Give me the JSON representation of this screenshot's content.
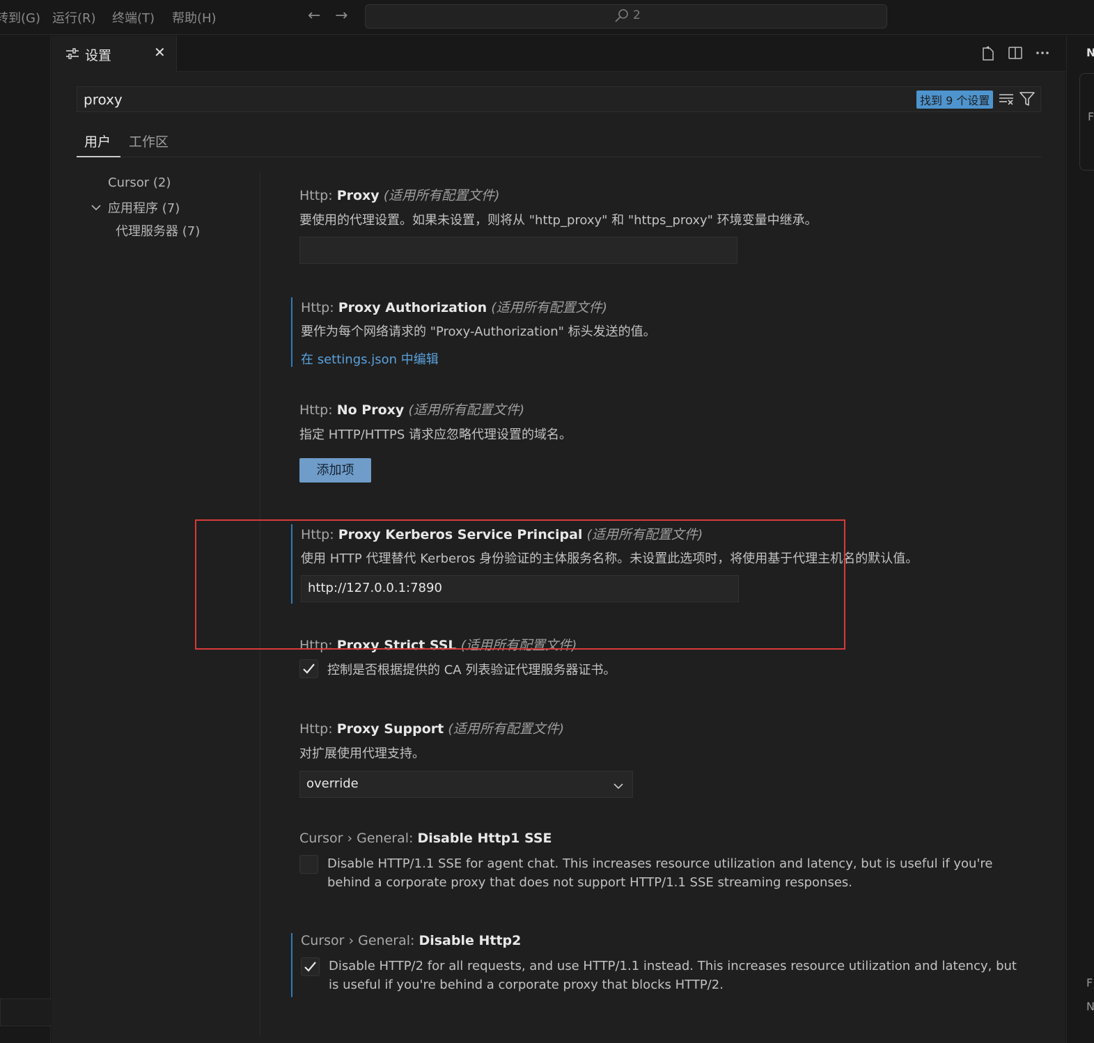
{
  "menubar": {
    "items": [
      "转到(G)",
      "运行(R)",
      "终端(T)",
      "帮助(H)"
    ],
    "back": "←",
    "forward": "→",
    "command_center": "2"
  },
  "tab": {
    "label": "设置",
    "close": "✕"
  },
  "search": {
    "query": "proxy",
    "found_badge": "找到 9 个设置"
  },
  "scope_tabs": [
    "用户",
    "工作区"
  ],
  "toc": {
    "cursor": "Cursor (2)",
    "application": "应用程序 (7)",
    "proxy_server": "代理服务器 (7)"
  },
  "settings": {
    "proxy": {
      "category": "Http: ",
      "name": "Proxy",
      "scope": "(适用所有配置文件)",
      "description": "要使用的代理设置。如果未设置，则将从 \"http_proxy\" 和 \"https_proxy\" 环境变量中继承。",
      "value": ""
    },
    "proxy_authorization": {
      "category": "Http: ",
      "name": "Proxy Authorization",
      "scope": "(适用所有配置文件)",
      "description": "要作为每个网络请求的 \"Proxy-Authorization\" 标头发送的值。",
      "link": "在 settings.json 中编辑"
    },
    "no_proxy": {
      "category": "Http: ",
      "name": "No Proxy",
      "scope": "(适用所有配置文件)",
      "description": "指定 HTTP/HTTPS 请求应忽略代理设置的域名。",
      "button": "添加项"
    },
    "kerberos": {
      "category": "Http: ",
      "name": "Proxy Kerberos Service Principal",
      "scope": "(适用所有配置文件)",
      "description": "使用 HTTP 代理替代 Kerberos 身份验证的主体服务名称。未设置此选项时，将使用基于代理主机名的默认值。",
      "value": "http://127.0.0.1:7890"
    },
    "strict_ssl": {
      "category": "Http: ",
      "name": "Proxy Strict SSL",
      "scope": "(适用所有配置文件)",
      "description": "控制是否根据提供的 CA 列表验证代理服务器证书。",
      "checked": true
    },
    "proxy_support": {
      "category": "Http: ",
      "name": "Proxy Support",
      "scope": "(适用所有配置文件)",
      "description": "对扩展使用代理支持。",
      "value": "override"
    },
    "disable_http1_sse": {
      "category": "Cursor › General: ",
      "name": "Disable Http1 SSE",
      "description": "Disable HTTP/1.1 SSE for agent chat. This increases resource utilization and latency, but is useful if you're behind a corporate proxy that does not support HTTP/1.1 SSE streaming responses.",
      "checked": false
    },
    "disable_http2": {
      "category": "Cursor › General: ",
      "name": "Disable Http2",
      "description": "Disable HTTP/2 for all requests, and use HTTP/1.1 instead. This increases resource utilization and latency, but is useful if you're behind a corporate proxy that blocks HTTP/2.",
      "checked": true
    }
  },
  "right_panel_letters": [
    "N",
    "F",
    "F",
    "N"
  ],
  "colors": {
    "accent": "#4e94ce",
    "modified_bar": "#2e7cba",
    "highlight_box": "#d93a3a",
    "button": "#6f9cc9"
  }
}
